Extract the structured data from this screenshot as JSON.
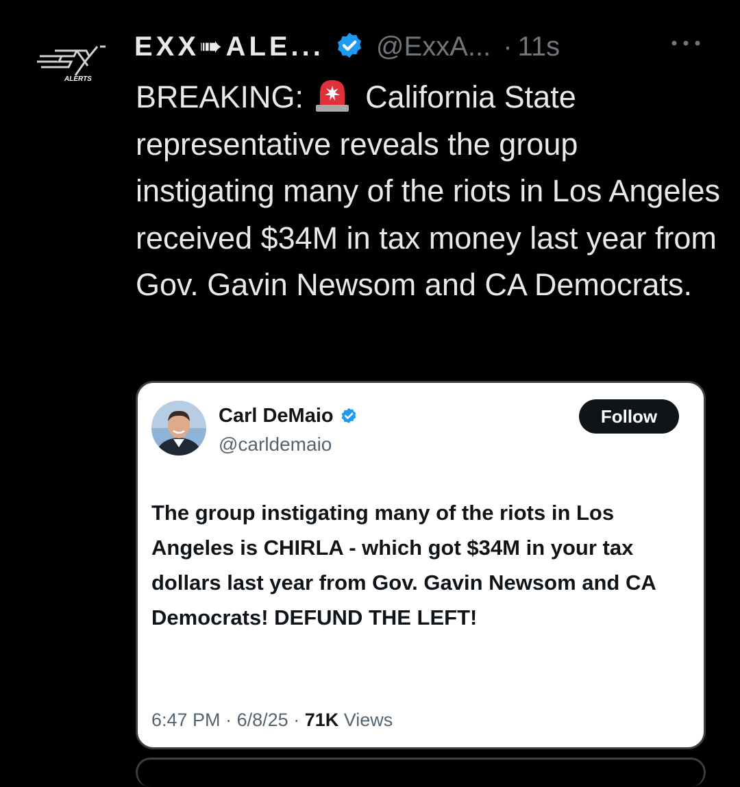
{
  "tweet": {
    "author_name": "EXX➠ALE...",
    "author_handle": "@ExxA...",
    "separator": "·",
    "time": "11s",
    "avatar_icon": "exx-alerts-logo",
    "avatar_logo_text": "ALERTS",
    "text": {
      "prefix": "BREAKING:",
      "emoji": "rotating-light-icon",
      "rest": "California State representative reveals the group instigating many of the riots in Los Angeles received  $34M in tax money  last year from Gov. Gavin Newsom and CA Democrats."
    },
    "more_icon": "more-dots-icon"
  },
  "quote": {
    "name": "Carl DeMaio",
    "handle": "@carldemaio",
    "follow_label": "Follow",
    "text": "The group instigating many of the riots in Los Angeles is CHIRLA - which got $34M in your tax dollars last year from Gov. Gavin Newsom and CA Democrats! DEFUND THE LEFT!",
    "time": "6:47 PM",
    "date": "6/8/25",
    "views_count": "71K",
    "views_label": "Views",
    "dot": "·"
  },
  "colors": {
    "background": "#000000",
    "text": "#e7e9ea",
    "muted": "#71767b",
    "verified": "#1d9bf0",
    "card_background": "#ffffff",
    "follow_button": "#0f1419"
  }
}
